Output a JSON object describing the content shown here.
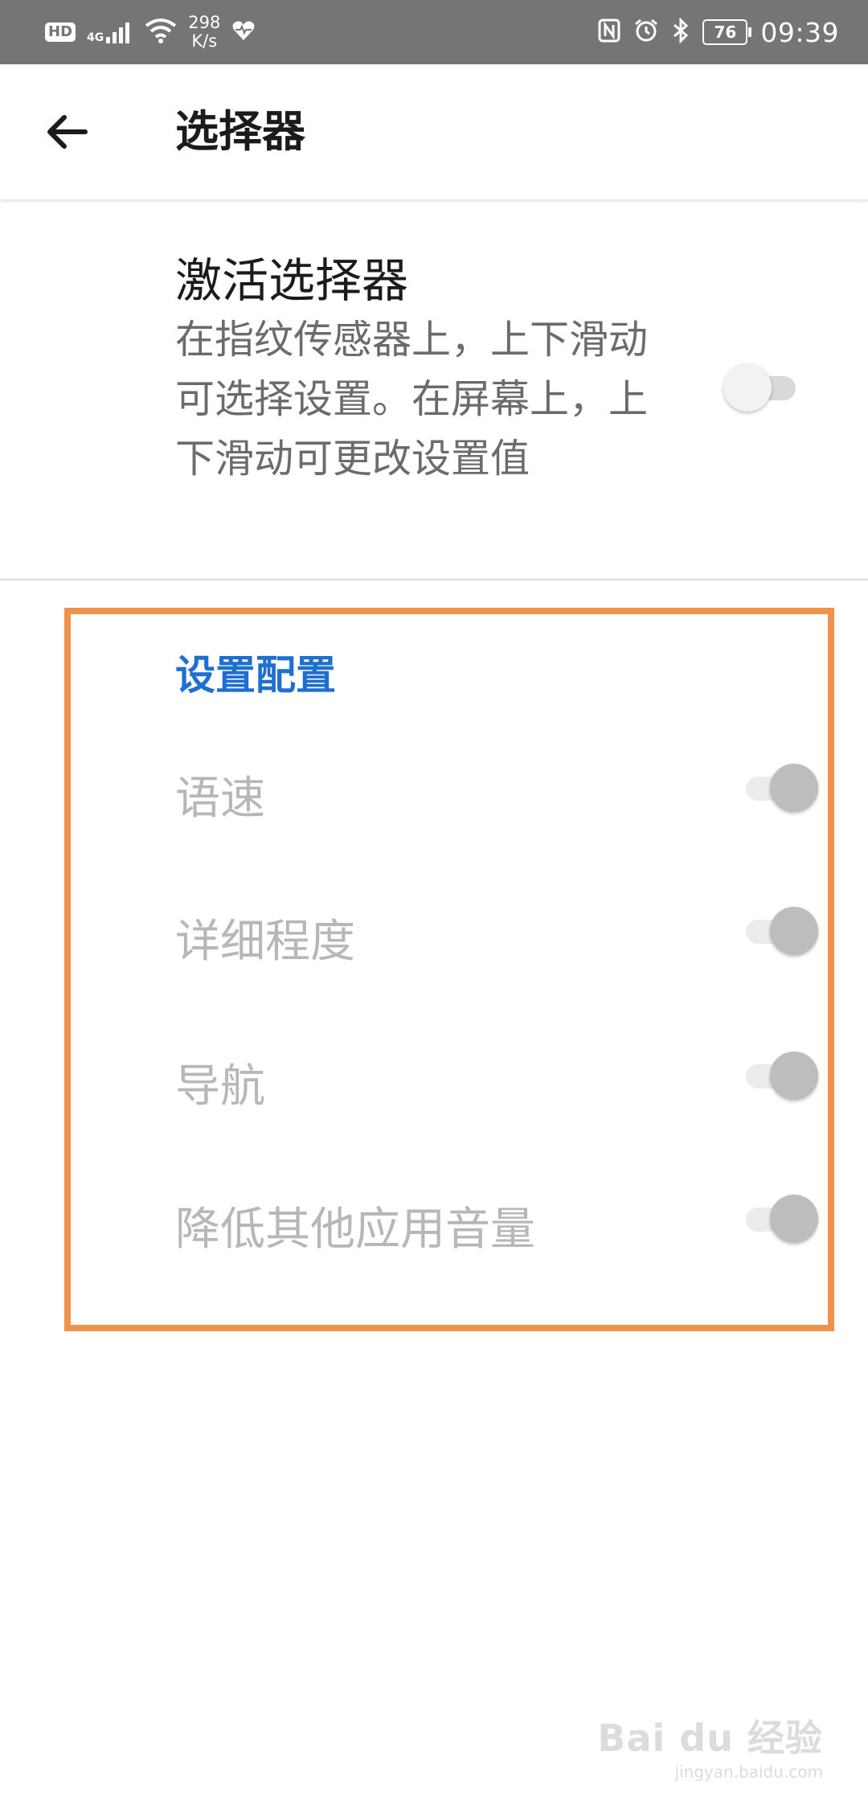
{
  "status_bar": {
    "hd": "HD",
    "network": "4G",
    "speed_value": "298",
    "speed_unit": "K/s",
    "battery": "76",
    "time": "09:39"
  },
  "app_bar": {
    "title": "选择器"
  },
  "activate": {
    "title": "激活选择器",
    "description": "在指纹传感器上，上下滑动可选择设置。在屏幕上，上下滑动可更改设置值",
    "enabled": false
  },
  "settings_config": {
    "header": "设置配置",
    "items": [
      {
        "label": "语速",
        "enabled": true
      },
      {
        "label": "详细程度",
        "enabled": true
      },
      {
        "label": "导航",
        "enabled": true
      },
      {
        "label": "降低其他应用音量",
        "enabled": true
      }
    ]
  },
  "watermark": {
    "main": "Bai du 经验",
    "sub": "jingyan.baidu.com"
  },
  "colors": {
    "highlight": "#f0924a",
    "section_header": "#1f6fd1",
    "disabled_text": "#b7b7b7"
  }
}
